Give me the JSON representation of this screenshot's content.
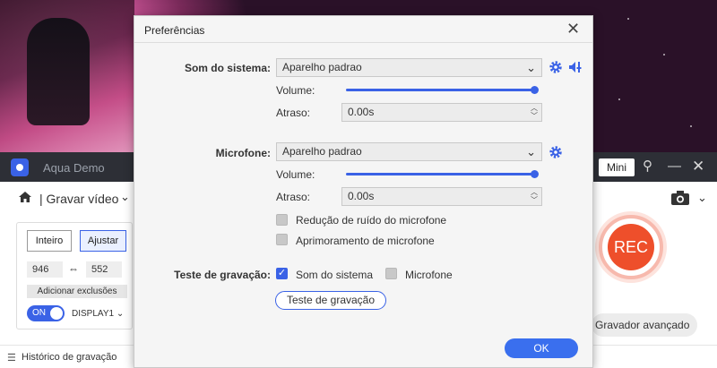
{
  "app": {
    "title": "Aqua Demo",
    "mini_label": "Mini",
    "mode_label": "Gravar vídeo",
    "region": {
      "full_label": "Inteiro",
      "custom_label": "Ajustar",
      "width": "946",
      "height": "552",
      "exclusions_label": "Adicionar exclusões",
      "toggle_label": "ON",
      "display_label": "DISPLAY1"
    },
    "rec_label": "REC",
    "advanced_label": "Gravador avançado",
    "history_label": "Histórico de gravação"
  },
  "dialog": {
    "title": "Preferências",
    "system_sound": {
      "label": "Som do sistema:",
      "device": "Aparelho padrao",
      "volume_label": "Volume:",
      "volume_level": 1.0,
      "delay_label": "Atraso:",
      "delay_value": "0.00s"
    },
    "microphone": {
      "label": "Microfone:",
      "device": "Aparelho padrao",
      "volume_label": "Volume:",
      "volume_level": 1.0,
      "delay_label": "Atraso:",
      "delay_value": "0.00s",
      "noise_reduction_label": "Redução de ruído do microfone",
      "noise_reduction_checked": false,
      "enhancement_label": "Aprimoramento de microfone",
      "enhancement_checked": false
    },
    "test": {
      "label": "Teste de gravação:",
      "system_sound_label": "Som do sistema",
      "system_sound_checked": true,
      "microphone_label": "Microfone",
      "microphone_checked": false,
      "button_label": "Teste de gravação"
    },
    "ok_label": "OK"
  },
  "colors": {
    "accent": "#3a62e6",
    "rec": "#ee4f2b"
  }
}
